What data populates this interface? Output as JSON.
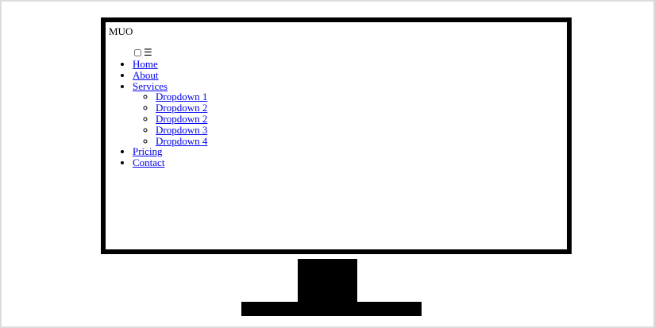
{
  "site": {
    "logo": "MUO",
    "menu_icon": "☰",
    "nav": {
      "items": [
        {
          "label": "Home"
        },
        {
          "label": "About"
        },
        {
          "label": "Services",
          "children": [
            "Dropdown 1",
            "Dropdown 2",
            "Dropdown 2",
            "Dropdown 3",
            "Dropdown 4"
          ]
        },
        {
          "label": "Pricing"
        },
        {
          "label": "Contact"
        }
      ]
    }
  },
  "colors": {
    "link": "#0000ee",
    "monitor_bezel": "#000000",
    "frame_border": "#dcdcdc"
  }
}
